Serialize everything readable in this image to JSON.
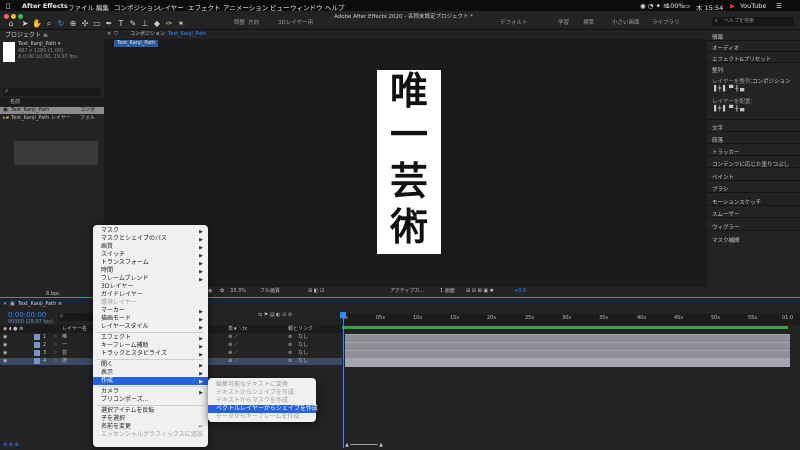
{
  "menubar": {
    "app": "After Effects",
    "items": [
      "ファイル",
      "編集",
      "コンポジション",
      "レイヤー",
      "エフェクト",
      "アニメーション",
      "ビュー",
      "ウィンドウ",
      "ヘルプ"
    ],
    "battery": "100%",
    "time": "木 15:54",
    "youtube": "YouTube"
  },
  "toolbar": {
    "title": "Adobe After Effects 2020 - 名称未設定プロジェクト *",
    "workspaces": [
      "デフォルト",
      "学習",
      "標準",
      "小さい画面",
      "ライブラリ"
    ],
    "snap_label": "調整",
    "snap_value": "方向",
    "layer3d": "3Dレイヤー用",
    "help_placeholder": "ヘルプを検索"
  },
  "project": {
    "title": "プロジェクト ≡",
    "comp_name": "Text_Kanji_Path ▾",
    "comp_size": "487 x 1280 (1.00)",
    "comp_duration": "Δ 0:00:10:00, 29.97 fps",
    "search_placeholder": "ρ",
    "col_name": "名前",
    "rows": [
      {
        "name": "Text_Kanji_Path",
        "type": "コンポ"
      },
      {
        "name": "Text_Kanji_Path レイヤー",
        "type": "フォル"
      }
    ],
    "bpc": "8 bpc"
  },
  "composition": {
    "tab_label": "コンポジション",
    "tab_name": "Text_Kanji_Path",
    "breadcrumb": "Text_Kanji_Path",
    "kanji": [
      "唯",
      "一",
      "芸",
      "術"
    ],
    "footer": {
      "zoom": "33.3%",
      "resolution": "フル画質",
      "camera": "アクティブカ...",
      "view": "1 画面",
      "exposure": "+0.0"
    }
  },
  "right_panel": {
    "items": [
      "情報",
      "オーディオ",
      "エフェクト&プリセット",
      "整列",
      "レイヤーを整列：",
      "コンポジション",
      "レイヤーを配置：",
      "文字",
      "段落",
      "トラッカー",
      "コンテンツに応じた塗りつぶし",
      "ペイント",
      "ブラシ",
      "モーションスケッチ",
      "スムーザー",
      "ウィグラー",
      "マスク補間"
    ]
  },
  "timeline": {
    "tab_name": "Text_Kanji_Path ≡",
    "timecode": "0:00:00:00",
    "timecode_sub": "00000 (29.97 fps)",
    "search_placeholder": "ρ",
    "col_layer": "レイヤー名",
    "col_switch": "単★＼fx",
    "col_parent": "親とリンク",
    "parent_value": "なし",
    "layers": [
      {
        "num": "1",
        "name": "唯"
      },
      {
        "num": "2",
        "name": "一"
      },
      {
        "num": "3",
        "name": "芸"
      },
      {
        "num": "4",
        "name": "術"
      }
    ],
    "ruler": [
      "0s",
      "05s",
      "10s",
      "15s",
      "20s",
      "25s",
      "30s",
      "35s",
      "40s",
      "45s",
      "50s",
      "55s",
      "01:0"
    ]
  },
  "context_menu": {
    "items": [
      {
        "label": "マスク",
        "arrow": true,
        "disabled": false
      },
      {
        "label": "マスクとシェイプのパス",
        "arrow": true,
        "disabled": false
      },
      {
        "label": "画質",
        "arrow": true,
        "disabled": false
      },
      {
        "label": "スイッチ",
        "arrow": true,
        "disabled": false
      },
      {
        "label": "トランスフォーム",
        "arrow": true,
        "disabled": false
      },
      {
        "label": "時間",
        "arrow": true,
        "disabled": false
      },
      {
        "label": "フレームブレンド",
        "arrow": true,
        "disabled": false
      },
      {
        "label": "3Dレイヤー",
        "arrow": false,
        "disabled": false
      },
      {
        "label": "ガイドレイヤー",
        "arrow": false,
        "disabled": false
      },
      {
        "label": "環境レイヤー",
        "arrow": false,
        "disabled": true
      },
      {
        "label": "マーカー",
        "arrow": true,
        "disabled": false
      },
      {
        "label": "描画モード",
        "arrow": true,
        "disabled": false
      },
      {
        "label": "レイヤースタイル",
        "arrow": true,
        "disabled": false
      },
      {
        "label": "エフェクト",
        "arrow": true,
        "disabled": false
      },
      {
        "label": "キーフレーム補助",
        "arrow": true,
        "disabled": false
      },
      {
        "label": "トラックとスタビライズ",
        "arrow": true,
        "disabled": false
      },
      {
        "label": "開く",
        "arrow": true,
        "disabled": false
      },
      {
        "label": "表示",
        "arrow": true,
        "disabled": false
      },
      {
        "label": "作成",
        "arrow": true,
        "disabled": false
      },
      {
        "label": "カメラ",
        "arrow": true,
        "disabled": false
      },
      {
        "label": "プリコンポーズ...",
        "arrow": false,
        "disabled": false
      },
      {
        "label": "選択アイテムを反転",
        "arrow": false,
        "disabled": false
      },
      {
        "label": "子を選択",
        "arrow": false,
        "disabled": false
      },
      {
        "label": "名前を変更",
        "arrow": false,
        "disabled": false
      },
      {
        "label": "エッセンシャルグラフィックスに追加",
        "arrow": false,
        "disabled": true
      }
    ],
    "rename_shortcut": "↵"
  },
  "submenu": {
    "items": [
      {
        "label": "編集可能なテキストに変換",
        "disabled": true
      },
      {
        "label": "テキストからシェイプを作成",
        "disabled": true
      },
      {
        "label": "テキストからマスクを作成",
        "disabled": true
      },
      {
        "label": "ベクトルレイヤーからシェイプを作成",
        "disabled": false
      },
      {
        "label": "データからキーフレームを作成",
        "disabled": true
      }
    ]
  },
  "colors": {
    "accent": "#2d8cff",
    "highlight": "#2563d9",
    "track": "#8e8e99"
  }
}
